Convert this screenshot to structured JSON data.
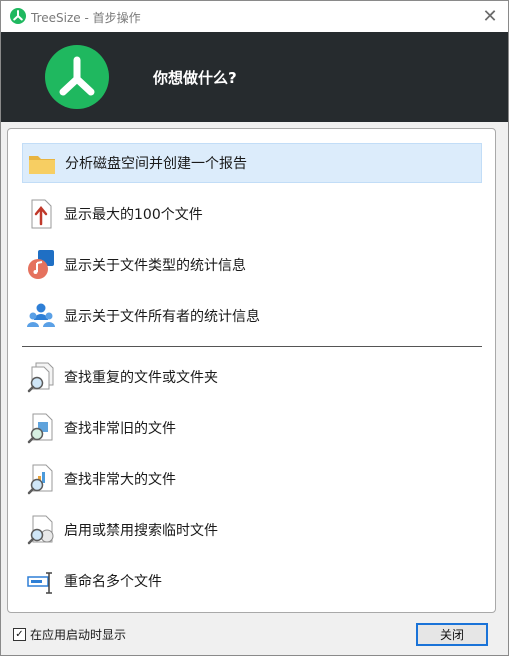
{
  "window": {
    "title": "TreeSize - 首步操作",
    "close_glyph": "✕"
  },
  "header": {
    "title": "你想做什么?"
  },
  "actions": [
    {
      "label": "分析磁盘空间并创建一个报告",
      "icon": "folder-icon",
      "selected": true
    },
    {
      "label": "显示最大的100个文件",
      "icon": "top-files-icon"
    },
    {
      "label": "显示关于文件类型的统计信息",
      "icon": "file-types-icon"
    },
    {
      "label": "显示关于文件所有者的统计信息",
      "icon": "file-owners-icon"
    },
    {
      "label": "查找重复的文件或文件夹",
      "icon": "duplicate-search-icon"
    },
    {
      "label": "查找非常旧的文件",
      "icon": "old-files-search-icon"
    },
    {
      "label": "查找非常大的文件",
      "icon": "large-files-search-icon"
    },
    {
      "label": "启用或禁用搜索临时文件",
      "icon": "temp-files-search-icon"
    },
    {
      "label": "重命名多个文件",
      "icon": "rename-icon"
    }
  ],
  "footer": {
    "startup_checkbox_label": "在应用启动时显示",
    "startup_checked": true,
    "check_glyph": "✓",
    "close_button_label": "关闭"
  },
  "colors": {
    "brand_green": "#1fb85f",
    "header_bg": "#262b2e",
    "selection_bg": "#dcecfb",
    "button_focus": "#1a73d8"
  }
}
